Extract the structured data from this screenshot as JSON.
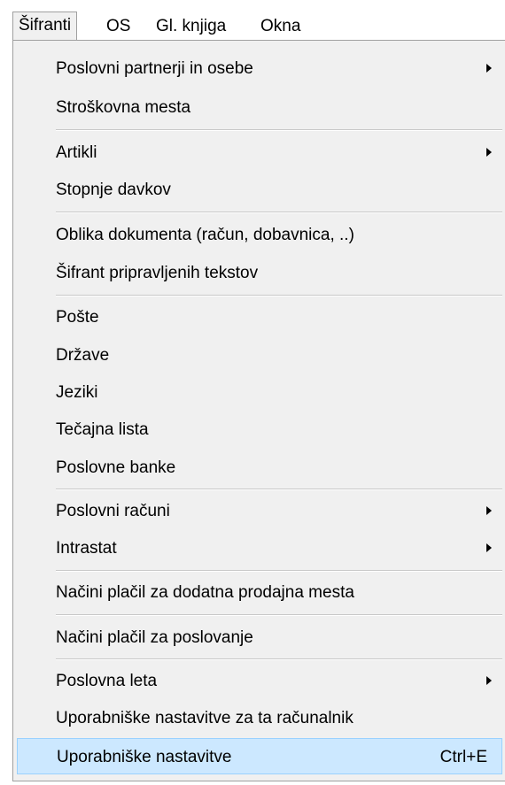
{
  "menubar": {
    "items": [
      {
        "label": "Šifranti"
      },
      {
        "label": "OS"
      },
      {
        "label": "Gl. knjiga"
      },
      {
        "label": "Okna"
      }
    ]
  },
  "menu": {
    "items": [
      {
        "label": "Poslovni partnerji in osebe",
        "submenu": true
      },
      {
        "label": "Stroškovna mesta"
      },
      {
        "label": "Artikli",
        "submenu": true
      },
      {
        "label": "Stopnje davkov"
      },
      {
        "label": "Oblika dokumenta (račun, dobavnica, ..)"
      },
      {
        "label": "Šifrant pripravljenih tekstov"
      },
      {
        "label": "Pošte"
      },
      {
        "label": "Države"
      },
      {
        "label": "Jeziki"
      },
      {
        "label": "Tečajna lista"
      },
      {
        "label": "Poslovne banke"
      },
      {
        "label": "Poslovni računi",
        "submenu": true
      },
      {
        "label": "Intrastat",
        "submenu": true
      },
      {
        "label": "Načini plačil za dodatna prodajna mesta"
      },
      {
        "label": "Načini plačil za poslovanje"
      },
      {
        "label": "Poslovna leta",
        "submenu": true
      },
      {
        "label": "Uporabniške nastavitve za ta računalnik"
      },
      {
        "label": "Uporabniške nastavitve",
        "shortcut": "Ctrl+E",
        "highlighted": true
      }
    ]
  },
  "colors": {
    "menu_background": "#f0f0f0",
    "highlight_background": "#cce8ff",
    "highlight_border": "#99d1ff"
  }
}
